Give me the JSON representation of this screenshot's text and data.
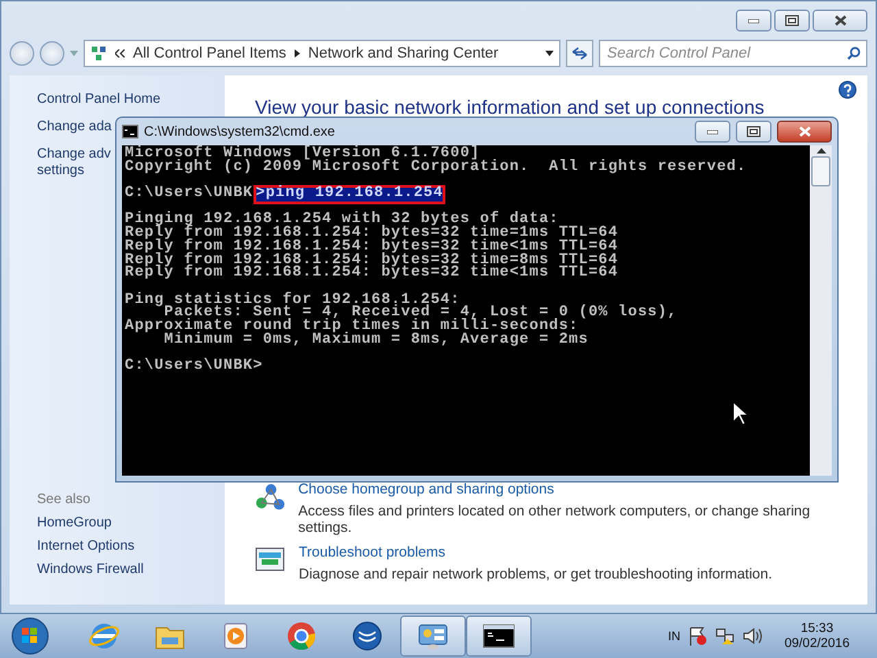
{
  "explorer": {
    "address": {
      "crumbs": [
        "All Control Panel Items",
        "Network and Sharing Center"
      ]
    },
    "search": {
      "placeholder": "Search Control Panel"
    },
    "sidebar": {
      "items": [
        {
          "text": "Control Panel Home"
        },
        {
          "text": "Change ada"
        },
        {
          "text": "Change adv\nsettings"
        }
      ],
      "see_also_title": "See also",
      "see_also": [
        "HomeGroup",
        "Internet Options",
        "Windows Firewall"
      ]
    },
    "heading": "View your basic network information and set up connections",
    "tasks": [
      {
        "kind": "homegroup",
        "title": "Choose homegroup and sharing options",
        "description": "Access files and printers located on other network computers, or change sharing settings."
      },
      {
        "kind": "troubleshoot",
        "title": "Troubleshoot problems",
        "description": "Diagnose and repair network problems, or get troubleshooting information."
      }
    ]
  },
  "console": {
    "title": "C:\\Windows\\system32\\cmd.exe",
    "blocks": [
      [
        {
          "kind": "output",
          "text": "Microsoft Windows [Version 6.1.7600]"
        },
        {
          "kind": "output",
          "text": "Copyright (c) 2009 Microsoft Corporation.  All rights reserved."
        }
      ],
      [
        {
          "kind": "command",
          "prompt": "C:\\Users\\UNBK",
          "command": ">ping 192.168.1.254",
          "highlighted": true
        }
      ],
      [
        {
          "kind": "output",
          "text": "Pinging 192.168.1.254 with 32 bytes of data:"
        },
        {
          "kind": "output",
          "text": "Reply from 192.168.1.254: bytes=32 time=1ms TTL=64"
        },
        {
          "kind": "output",
          "text": "Reply from 192.168.1.254: bytes=32 time<1ms TTL=64"
        },
        {
          "kind": "output",
          "text": "Reply from 192.168.1.254: bytes=32 time=8ms TTL=64"
        },
        {
          "kind": "output",
          "text": "Reply from 192.168.1.254: bytes=32 time<1ms TTL=64"
        }
      ],
      [
        {
          "kind": "output",
          "text": "Ping statistics for 192.168.1.254:"
        },
        {
          "kind": "output",
          "text": "    Packets: Sent = 4, Received = 4, Lost = 0 (0% loss),"
        },
        {
          "kind": "output",
          "text": "Approximate round trip times in milli-seconds:"
        },
        {
          "kind": "output",
          "text": "    Minimum = 0ms, Maximum = 8ms, Average = 2ms"
        }
      ],
      [
        {
          "kind": "output",
          "text": "C:\\Users\\UNBK>"
        }
      ]
    ]
  },
  "taskbar": {
    "apps": [
      {
        "kind": "ie",
        "active": false
      },
      {
        "kind": "folder",
        "active": false
      },
      {
        "kind": "player",
        "active": false
      },
      {
        "kind": "chrome",
        "active": false
      },
      {
        "kind": "bluecircle",
        "active": false
      },
      {
        "kind": "controlpanel",
        "active": true
      },
      {
        "kind": "cmd",
        "active": true
      }
    ],
    "tray": {
      "language": "IN",
      "time": "15:33",
      "date": "09/02/2016"
    }
  }
}
